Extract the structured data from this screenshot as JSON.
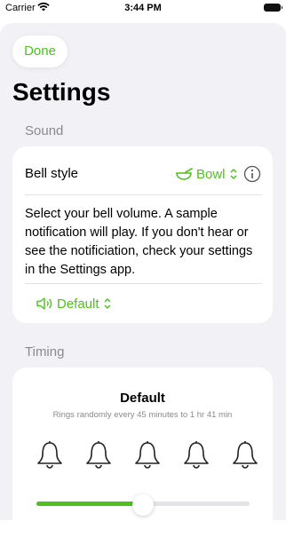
{
  "status_bar": {
    "carrier": "Carrier",
    "time": "3:44 PM"
  },
  "header": {
    "done_label": "Done",
    "title": "Settings"
  },
  "sound": {
    "section_title": "Sound",
    "bell_style_label": "Bell style",
    "bell_style_value": "Bowl",
    "description": "Select your bell volume.  A sample notification will play.  If you don't hear or see the notificiation, check your settings in the Settings app.",
    "volume_value": "Default"
  },
  "timing": {
    "section_title": "Timing",
    "mode_title": "Default",
    "mode_subtitle": "Rings randomly every 45 minutes to 1 hr 41 min",
    "bell_count": 5,
    "slider_fraction": 0.5
  },
  "colors": {
    "accent": "#4cc21c",
    "background": "#f1f1f6",
    "secondary_text": "#8a8a8e"
  }
}
